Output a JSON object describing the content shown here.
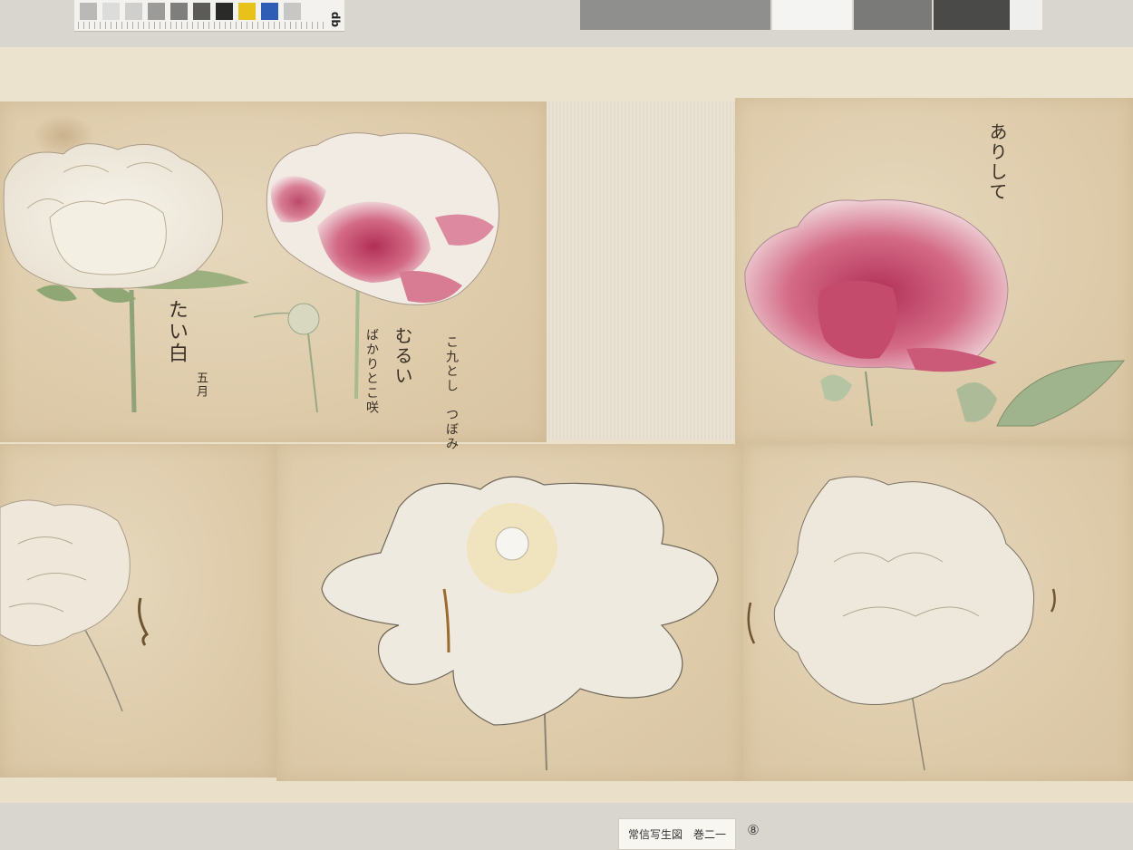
{
  "label": {
    "title": "常信写生図　巻二一",
    "number": "⑧"
  },
  "calibration": {
    "brand": "qp",
    "swatches": [
      "#b9b9b7",
      "#dcdcda",
      "#cfcfcd",
      "#9b9b99",
      "#7e7e7c",
      "#5b5b59",
      "#2a2a28",
      "#e8c21a",
      "#2f5db5",
      "#c7c7c5"
    ]
  },
  "inscriptions": {
    "white_peony_name": "たい白",
    "white_peony_note": "五月",
    "pink_peony_name": "むるい",
    "pink_peony_note_1": "こ九とし　つぼみ",
    "pink_peony_note_2": "ばかりとこ咲",
    "right_peony_name": "ありして"
  },
  "colors": {
    "paper": "#dcc9a7",
    "mount": "#eadfc8",
    "peony_pink": "#b83a5c",
    "leaf_green": "#9bb07e"
  }
}
